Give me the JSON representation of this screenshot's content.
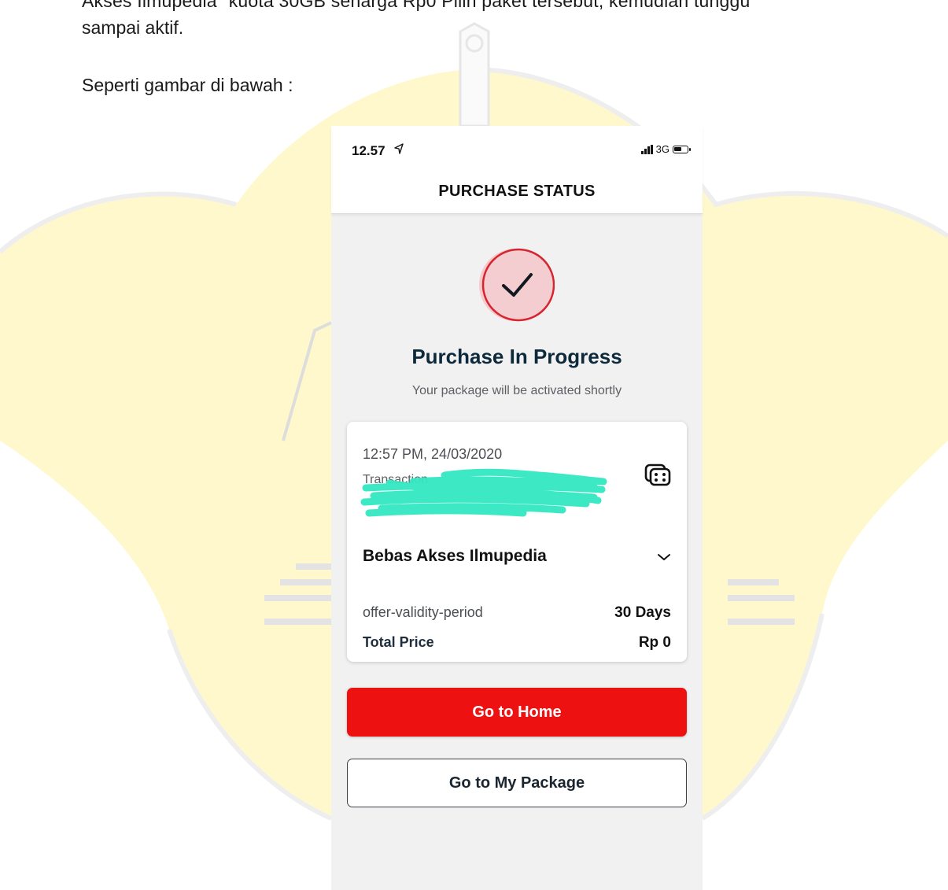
{
  "document": {
    "line1": "Akses Ilmupedia\" kuota 30GB seharga Rp0 Pilih paket tersebut, kemudian tunggu",
    "line2": "sampai aktif.",
    "line3": "Seperti gambar di bawah :"
  },
  "phone": {
    "status_bar": {
      "time": "12.57",
      "network": "3G"
    },
    "header": {
      "title": "PURCHASE STATUS"
    },
    "status": {
      "headline": "Purchase In Progress",
      "subtitle": "Your package will be activated shortly"
    },
    "transaction": {
      "datetime": "12:57 PM, 24/03/2020",
      "id_label": "Transaction"
    },
    "package": {
      "name": "Bebas Akses Ilmupedia",
      "validity_label": "offer-validity-period",
      "validity_value": "30 Days",
      "price_label": "Total Price",
      "price_value": "Rp 0"
    },
    "buttons": {
      "home": "Go to Home",
      "my_package": "Go to My Package"
    }
  },
  "colors": {
    "primary_red": "#ee1111",
    "heading_navy": "#0d2a3c",
    "watermark_yellow": "#fff8cc",
    "redaction_teal": "#33e8c2"
  }
}
